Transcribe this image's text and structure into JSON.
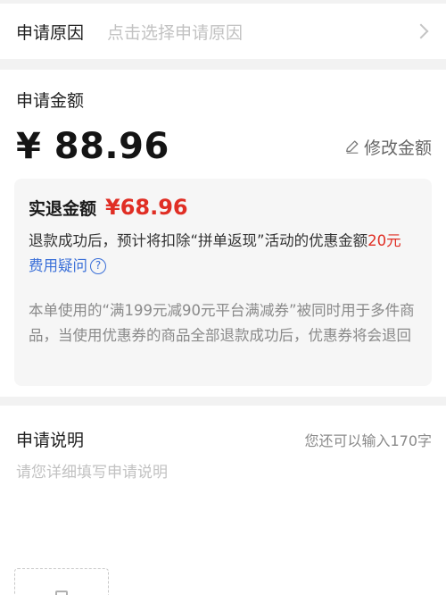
{
  "reason": {
    "label": "申请原因",
    "placeholder": "点击选择申请原因"
  },
  "amount": {
    "label": "申请金额",
    "value": "¥ 88.96",
    "modify_label": "修改金额"
  },
  "refund": {
    "title": "实退金额",
    "amount": "¥68.96",
    "desc_before": "退款成功后，预计将扣除“拼单返现”活动的优惠金额",
    "desc_highlight": "20元",
    "faq_label": "费用疑问",
    "faq_icon": "?",
    "coupon_note": "本单使用的“满199元减90元平台满减券”被同时用于多件商品，当使用优惠券的商品全部退款成功后，优惠券将会退回"
  },
  "description": {
    "title": "申请说明",
    "counter": "您还可以输入170字",
    "placeholder": "请您详细填写申请说明"
  },
  "colors": {
    "accent_red": "#e02e24",
    "link_blue": "#3a6fd8"
  }
}
